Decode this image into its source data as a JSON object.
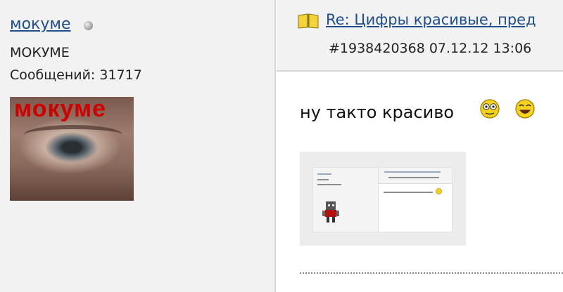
{
  "user": {
    "username": "мокуме",
    "title": "МОКУМЕ",
    "posts_label": "Сообщений: 31717",
    "avatar_text": "мокуме"
  },
  "post": {
    "icon": "book-icon",
    "title": "Re: Цифры красивые, пред",
    "meta": "#1938420368 07.12.12 13:06",
    "text": "ну такто красиво",
    "smileys": [
      "dizzy-smiley-icon",
      "laughing-smiley-icon"
    ],
    "attachment_icon": "screenshot-thumbnail"
  },
  "colors": {
    "link": "#1f4e8c",
    "panel_bg": "#f2f2f2",
    "avatar_text": "#d10000"
  }
}
